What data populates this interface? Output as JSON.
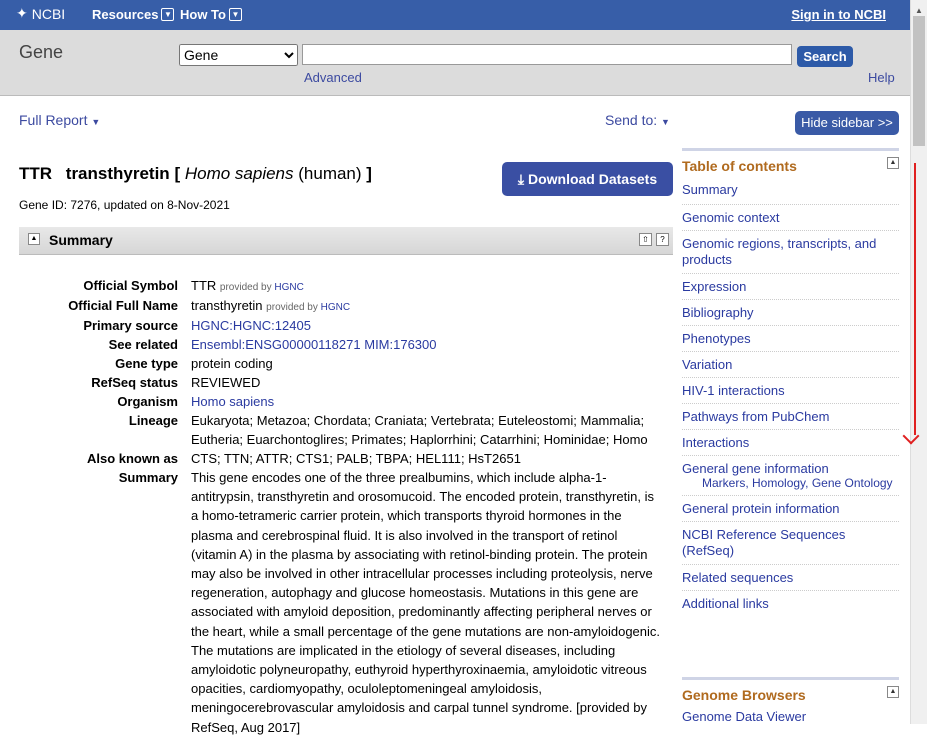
{
  "header": {
    "logo_text": "NCBI",
    "resources_label": "Resources",
    "howto_label": "How To",
    "signin_label": "Sign in to NCBI"
  },
  "search": {
    "db_title": "Gene",
    "db_selected": "Gene",
    "query": "",
    "search_label": "Search",
    "advanced_label": "Advanced",
    "help_label": "Help"
  },
  "toolbar": {
    "full_report_label": "Full Report",
    "send_to_label": "Send to:",
    "hide_sidebar_label": "Hide sidebar >>"
  },
  "gene": {
    "symbol": "TTR",
    "name": "transthyretin",
    "bracket_open": "[",
    "organism_italic": "Homo sapiens",
    "organism_common": "(human)",
    "bracket_close": "]",
    "id_line": "Gene ID: 7276, updated on 8-Nov-2021",
    "download_label": "Download Datasets"
  },
  "summary_section": {
    "title": "Summary",
    "fields": {
      "official_symbol": {
        "label": "Official Symbol",
        "value": "TTR",
        "provided_by": "provided by",
        "source": "HGNC"
      },
      "official_full_name": {
        "label": "Official Full Name",
        "value": "transthyretin",
        "provided_by": "provided by",
        "source": "HGNC"
      },
      "primary_source": {
        "label": "Primary source",
        "value": "HGNC:HGNC:12405"
      },
      "see_related": {
        "label": "See related",
        "link1": "Ensembl:ENSG00000118271",
        "link2": "MIM:176300"
      },
      "gene_type": {
        "label": "Gene type",
        "value": "protein coding"
      },
      "refseq_status": {
        "label": "RefSeq status",
        "value": "REVIEWED"
      },
      "organism": {
        "label": "Organism",
        "value": "Homo sapiens"
      },
      "lineage": {
        "label": "Lineage",
        "value": "Eukaryota; Metazoa; Chordata; Craniata; Vertebrata; Euteleostomi; Mammalia; Eutheria; Euarchontoglires; Primates; Haplorrhini; Catarrhini; Hominidae; Homo"
      },
      "also_known_as": {
        "label": "Also known as",
        "value": "CTS; TTN; ATTR; CTS1; PALB; TBPA; HEL111; HsT2651"
      },
      "summary": {
        "label": "Summary",
        "value": "This gene encodes one of the three prealbumins, which include alpha-1-antitrypsin, transthyretin and orosomucoid. The encoded protein, transthyretin, is a homo-tetrameric carrier protein, which transports thyroid hormones in the plasma and cerebrospinal fluid. It is also involved in the transport of retinol (vitamin A) in the plasma by associating with retinol-binding protein. The protein may also be involved in other intracellular processes including proteolysis, nerve regeneration, autophagy and glucose homeostasis. Mutations in this gene are associated with amyloid deposition, predominantly affecting peripheral nerves or the heart, while a small percentage of the gene mutations are non-amyloidogenic. The mutations are implicated in the etiology of several diseases, including amyloidotic polyneuropathy, euthyroid hyperthyroxinaemia, amyloidotic vitreous opacities, cardiomyopathy, oculoleptomeningeal amyloidosis, meningocerebrovascular amyloidosis and carpal tunnel syndrome. [provided by RefSeq, Aug 2017]"
      }
    }
  },
  "sidebar": {
    "toc_title": "Table of contents",
    "toc_items": [
      "Summary",
      "Genomic context",
      "Genomic regions, transcripts, and products",
      "Expression",
      "Bibliography",
      "Phenotypes",
      "Variation",
      "HIV-1 interactions",
      "Pathways from PubChem",
      "Interactions",
      "General gene information",
      "General protein information",
      "NCBI Reference Sequences (RefSeq)",
      "Related sequences",
      "Additional links"
    ],
    "general_gene_subitems": [
      "Markers,",
      "Homology,",
      "Gene Ontology"
    ],
    "genome_browsers_title": "Genome Browsers",
    "genome_browsers_items": [
      "Genome Data Viewer"
    ]
  },
  "colors": {
    "header_bg": "#375ea8",
    "button_blue": "#3a4fa3",
    "toc_heading": "#b06a1e",
    "link": "#2a3aa0",
    "annotation_arrow": "#e02020"
  }
}
